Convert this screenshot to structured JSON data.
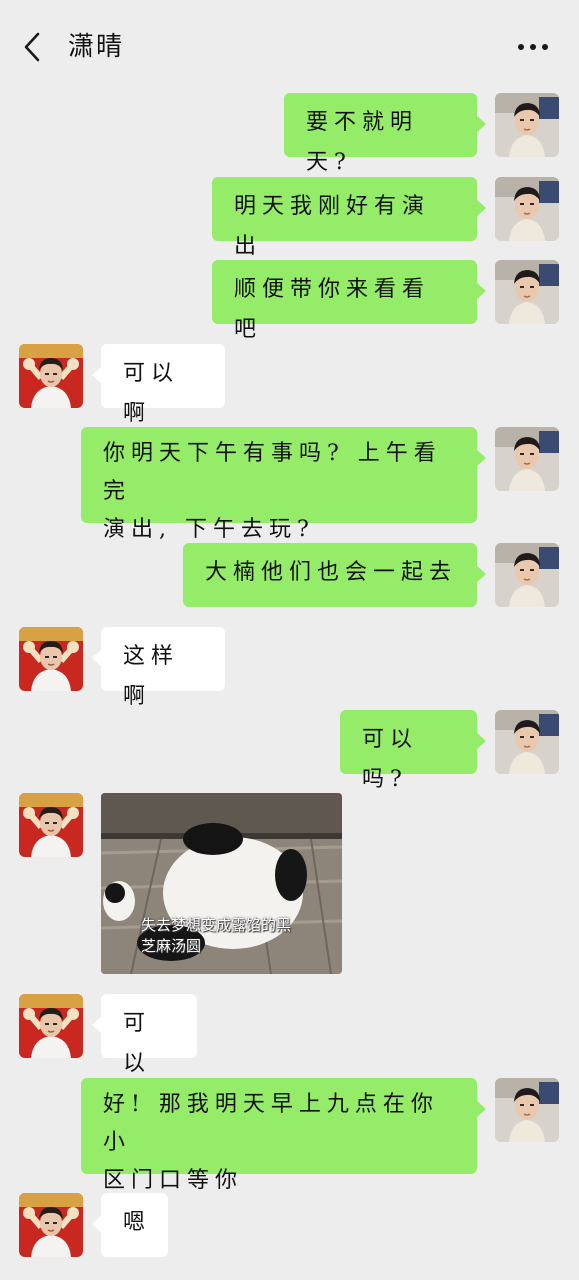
{
  "header": {
    "title": "潇晴",
    "back_icon": "chevron-left-icon",
    "more_icon": "more-dots-icon"
  },
  "colors": {
    "background": "#ededed",
    "sent_bubble": "#95ec69",
    "received_bubble": "#ffffff"
  },
  "messages": [
    {
      "side": "sent",
      "text": "要不就明天?"
    },
    {
      "side": "sent",
      "text": "明天我刚好有演出"
    },
    {
      "side": "sent",
      "text": "顺便带你来看看吧"
    },
    {
      "side": "received",
      "text": "可以啊"
    },
    {
      "side": "sent",
      "text": "你明天下午有事吗? 上午看完\n演出, 下午去玩?"
    },
    {
      "side": "sent",
      "text": "大楠他们也会一起去"
    },
    {
      "side": "received",
      "text": "这样啊"
    },
    {
      "side": "sent",
      "text": "可以吗?"
    },
    {
      "side": "received",
      "type": "sticker",
      "caption": "失去梦想变成露馅的黑\n芝麻汤圆",
      "icon": "panda-sticker"
    },
    {
      "side": "received",
      "text": "可以"
    },
    {
      "side": "sent",
      "text": "好! 那我明天早上九点在你小\n区门口等你"
    },
    {
      "side": "received",
      "text": "嗯"
    }
  ]
}
